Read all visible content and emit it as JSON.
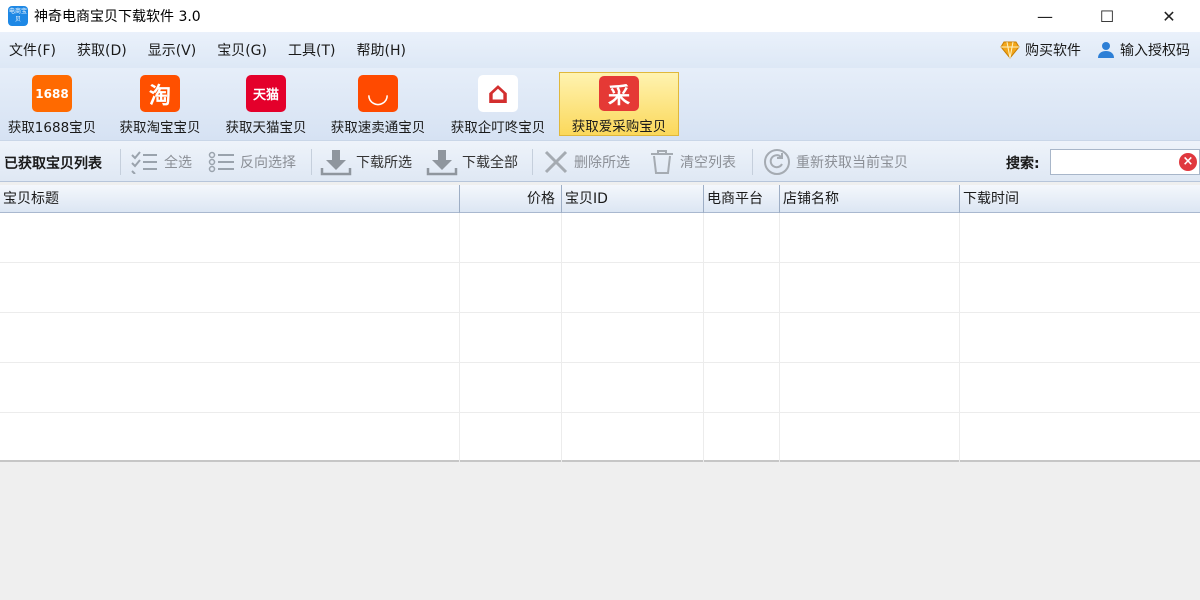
{
  "window": {
    "title": "神奇电商宝贝下载软件 3.0",
    "icon_text": "电商宝贝",
    "controls": [
      "—",
      "☐",
      "✕"
    ]
  },
  "menu": {
    "items": [
      "文件(F)",
      "获取(D)",
      "显示(V)",
      "宝贝(G)",
      "工具(T)",
      "帮助(H)"
    ],
    "right": {
      "buy": "购买软件",
      "license": "输入授权码"
    }
  },
  "ribbon": {
    "buttons": [
      {
        "label": "获取1688宝贝",
        "icon": "1688",
        "color": "#ff6a00"
      },
      {
        "label": "获取淘宝宝贝",
        "icon": "淘",
        "color": "#ff5000"
      },
      {
        "label": "获取天猫宝贝",
        "icon": "天猫",
        "color": "#e4002b"
      },
      {
        "label": "获取速卖通宝贝",
        "icon": "◡",
        "color": "#ff4a00"
      },
      {
        "label": "获取企叮咚宝贝",
        "icon": "⌂",
        "color": "#d32f2f"
      },
      {
        "label": "获取爱采购宝贝",
        "icon": "采",
        "color": "#e53935",
        "active": true
      }
    ]
  },
  "toolbar": {
    "title": "已获取宝贝列表",
    "select_all": "全选",
    "invert": "反向选择",
    "download_selected": "下载所选",
    "download_all": "下载全部",
    "delete_selected": "删除所选",
    "clear_list": "清空列表",
    "refetch": "重新获取当前宝贝",
    "search_label": "搜索:",
    "search_value": "",
    "search_placeholder": ""
  },
  "table": {
    "columns": [
      "宝贝标题",
      "价格",
      "宝贝ID",
      "电商平台",
      "店铺名称",
      "下载时间"
    ],
    "rows": []
  }
}
